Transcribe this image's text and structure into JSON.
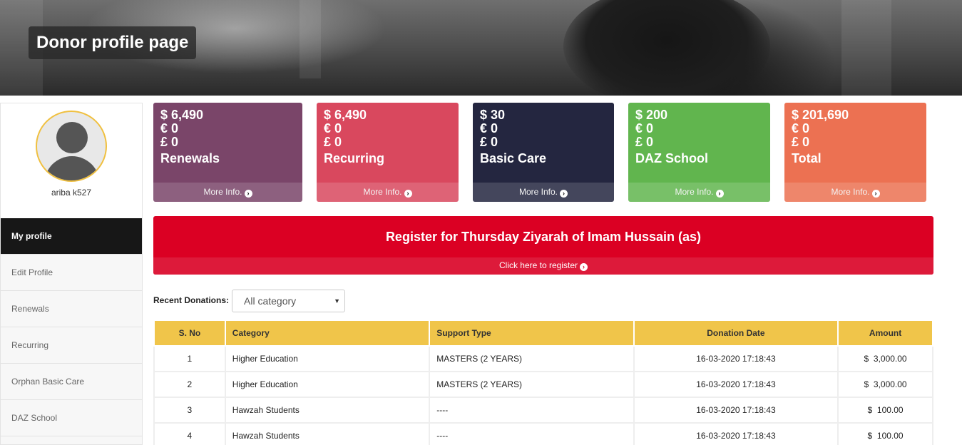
{
  "banner": {
    "title": "Donor profile page"
  },
  "profile": {
    "username": "ariba k527"
  },
  "sidebar": {
    "items": [
      {
        "label": "My profile",
        "active": true
      },
      {
        "label": "Edit Profile",
        "active": false
      },
      {
        "label": "Renewals",
        "active": false
      },
      {
        "label": "Recurring",
        "active": false
      },
      {
        "label": "Orphan Basic Care",
        "active": false
      },
      {
        "label": "DAZ School",
        "active": false
      }
    ]
  },
  "cards": [
    {
      "usd": "$ 6,490",
      "eur": "€ 0",
      "gbp": "£ 0",
      "label": "Renewals",
      "more": "More Info.",
      "color": "#7a4569"
    },
    {
      "usd": "$ 6,490",
      "eur": "€ 0",
      "gbp": "£ 0",
      "label": "Recurring",
      "more": "More Info.",
      "color": "#d9485e"
    },
    {
      "usd": "$ 30",
      "eur": "€ 0",
      "gbp": "£ 0",
      "label": "Basic Care",
      "more": "More Info.",
      "color": "#242640"
    },
    {
      "usd": "$ 200",
      "eur": "€ 0",
      "gbp": "£ 0",
      "label": "DAZ School",
      "more": "More Info.",
      "color": "#61b54e"
    },
    {
      "usd": "$ 201,690",
      "eur": "€ 0",
      "gbp": "£ 0",
      "label": "Total",
      "more": "More Info.",
      "color": "#ec7152"
    }
  ],
  "register": {
    "title": "Register for Thursday Ziyarah of Imam Hussain (as)",
    "link": "Click here to register"
  },
  "filter": {
    "label": "Recent Donations:",
    "selected": "All category"
  },
  "table": {
    "headers": [
      "S. No",
      "Category",
      "Support Type",
      "Donation Date",
      "Amount"
    ],
    "rows": [
      {
        "sno": "1",
        "category": "Higher Education",
        "support": "MASTERS (2 YEARS)",
        "date": "16-03-2020 17:18:43",
        "currency": "$",
        "amount": "3,000.00"
      },
      {
        "sno": "2",
        "category": "Higher Education",
        "support": "MASTERS (2 YEARS)",
        "date": "16-03-2020 17:18:43",
        "currency": "$",
        "amount": "3,000.00"
      },
      {
        "sno": "3",
        "category": "Hawzah Students",
        "support": "----",
        "date": "16-03-2020 17:18:43",
        "currency": "$",
        "amount": "100.00"
      },
      {
        "sno": "4",
        "category": "Hawzah Students",
        "support": "----",
        "date": "16-03-2020 17:18:43",
        "currency": "$",
        "amount": "100.00"
      }
    ]
  },
  "icons": {
    "more_arrow": "arrow-circle-right-icon",
    "avatar": "user-avatar-icon"
  }
}
